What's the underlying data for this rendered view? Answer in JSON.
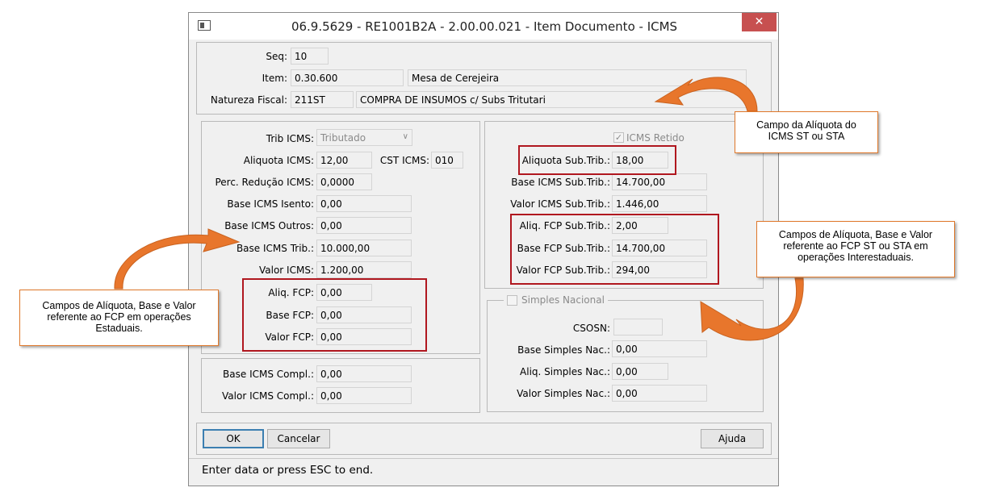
{
  "window": {
    "title": "06.9.5629 - RE1001B2A - 2.00.00.021 - Item Documento - ICMS",
    "close_glyph": "✕"
  },
  "header": {
    "seq_label": "Seq:",
    "seq_value": "10",
    "item_label": "Item:",
    "item_code": "0.30.600",
    "item_desc": "Mesa de Cerejeira",
    "natureza_label": "Natureza Fiscal:",
    "natureza_code": "211ST",
    "natureza_desc": "COMPRA DE INSUMOS c/ Subs Tritutari"
  },
  "left_panel": {
    "trib_label": "Trib ICMS:",
    "trib_value": "Tributado",
    "aliquota_label": "Aliquota ICMS:",
    "aliquota_value": "12,00",
    "cst_label": "CST ICMS:",
    "cst_value": "010",
    "perc_reducao_label": "Perc. Redução ICMS:",
    "perc_reducao_value": "0,0000",
    "base_isento_label": "Base ICMS Isento:",
    "base_isento_value": "0,00",
    "base_outros_label": "Base ICMS Outros:",
    "base_outros_value": "0,00",
    "base_trib_label": "Base ICMS Trib.:",
    "base_trib_value": "10.000,00",
    "valor_icms_label": "Valor ICMS:",
    "valor_icms_value": "1.200,00",
    "aliq_fcp_label": "Aliq. FCP:",
    "aliq_fcp_value": "0,00",
    "base_fcp_label": "Base FCP:",
    "base_fcp_value": "0,00",
    "valor_fcp_label": "Valor FCP:",
    "valor_fcp_value": "0,00"
  },
  "compl_panel": {
    "base_compl_label": "Base ICMS Compl.:",
    "base_compl_value": "0,00",
    "valor_compl_label": "Valor ICMS Compl.:",
    "valor_compl_value": "0,00"
  },
  "right_panel": {
    "icms_retido_label": "ICMS Retido",
    "icms_retido_checked": true,
    "aliquota_st_label": "Aliquota Sub.Trib.:",
    "aliquota_st_value": "18,00",
    "base_st_label": "Base ICMS Sub.Trib.:",
    "base_st_value": "14.700,00",
    "valor_st_label": "Valor ICMS Sub.Trib.:",
    "valor_st_value": "1.446,00",
    "aliq_fcp_st_label": "Aliq. FCP Sub.Trib.:",
    "aliq_fcp_st_value": "2,00",
    "base_fcp_st_label": "Base FCP Sub.Trib.:",
    "base_fcp_st_value": "14.700,00",
    "valor_fcp_st_label": "Valor FCP Sub.Trib.:",
    "valor_fcp_st_value": "294,00"
  },
  "simples_panel": {
    "title": "Simples Nacional",
    "checked": false,
    "csosn_label": "CSOSN:",
    "csosn_value": "",
    "base_label": "Base Simples Nac.:",
    "base_value": "0,00",
    "aliq_label": "Aliq. Simples Nac.:",
    "aliq_value": "0,00",
    "valor_label": "Valor Simples Nac.:",
    "valor_value": "0,00"
  },
  "buttons": {
    "ok": "OK",
    "cancelar": "Cancelar",
    "ajuda": "Ajuda"
  },
  "status": {
    "text": "Enter data or press ESC to end."
  },
  "callouts": {
    "aliquota_st": "Campo da Alíquota do ICMS ST ou STA",
    "fcp_st": "Campos de Alíquota, Base e Valor referente ao FCP ST ou STA em operações Interestaduais.",
    "fcp_estadual": "Campos de Alíquota, Base e Valor referente ao FCP em operações Estaduais."
  },
  "colors": {
    "highlight_red": "#b0171f",
    "callout_orange": "#e0782a",
    "arrow_orange": "#e8762c",
    "close_red": "#c75050"
  }
}
